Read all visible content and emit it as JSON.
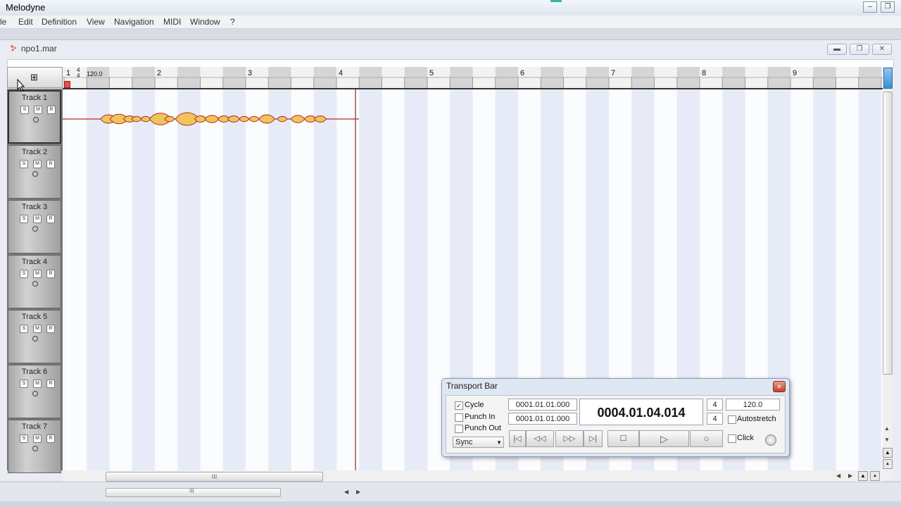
{
  "app": {
    "title": "Melodyne",
    "menu": [
      "le",
      "Edit",
      "Definition",
      "View",
      "Navigation",
      "MIDI",
      "Window",
      "?"
    ]
  },
  "document": {
    "title": "npo1.mar"
  },
  "ruler": {
    "time_signature_top": "4",
    "time_signature_bottom": "4",
    "tempo": "120.0",
    "bars": [
      "1",
      "2",
      "3",
      "4",
      "5",
      "6",
      "7",
      "8",
      "9"
    ]
  },
  "tracks": [
    {
      "name": "Track 1",
      "selected": true
    },
    {
      "name": "Track 2"
    },
    {
      "name": "Track 3"
    },
    {
      "name": "Track 4"
    },
    {
      "name": "Track 5"
    },
    {
      "name": "Track 6"
    },
    {
      "name": "Track 7"
    }
  ],
  "track_buttons": {
    "solo": "S",
    "mute": "M",
    "record": "R"
  },
  "transport": {
    "title": "Transport Bar",
    "cycle_label": "Cycle",
    "cycle_checked": true,
    "punch_in_label": "Punch In",
    "punch_out_label": "Punch Out",
    "sync_label": "Sync",
    "start_time": "0001.01.01.000",
    "end_time": "0001.01.01.000",
    "position": "0004.01.04.014",
    "sig_numerator": "4",
    "sig_denominator": "4",
    "tempo": "120.0",
    "autostretch_label": "Autostretch",
    "click_label": "Click"
  },
  "scroll_grip": "III",
  "colors": {
    "blob_fill": "#f0c45a",
    "blob_stroke": "#b0292a",
    "playhead": "#a0231f",
    "grid_band": "#e6ebf7"
  }
}
